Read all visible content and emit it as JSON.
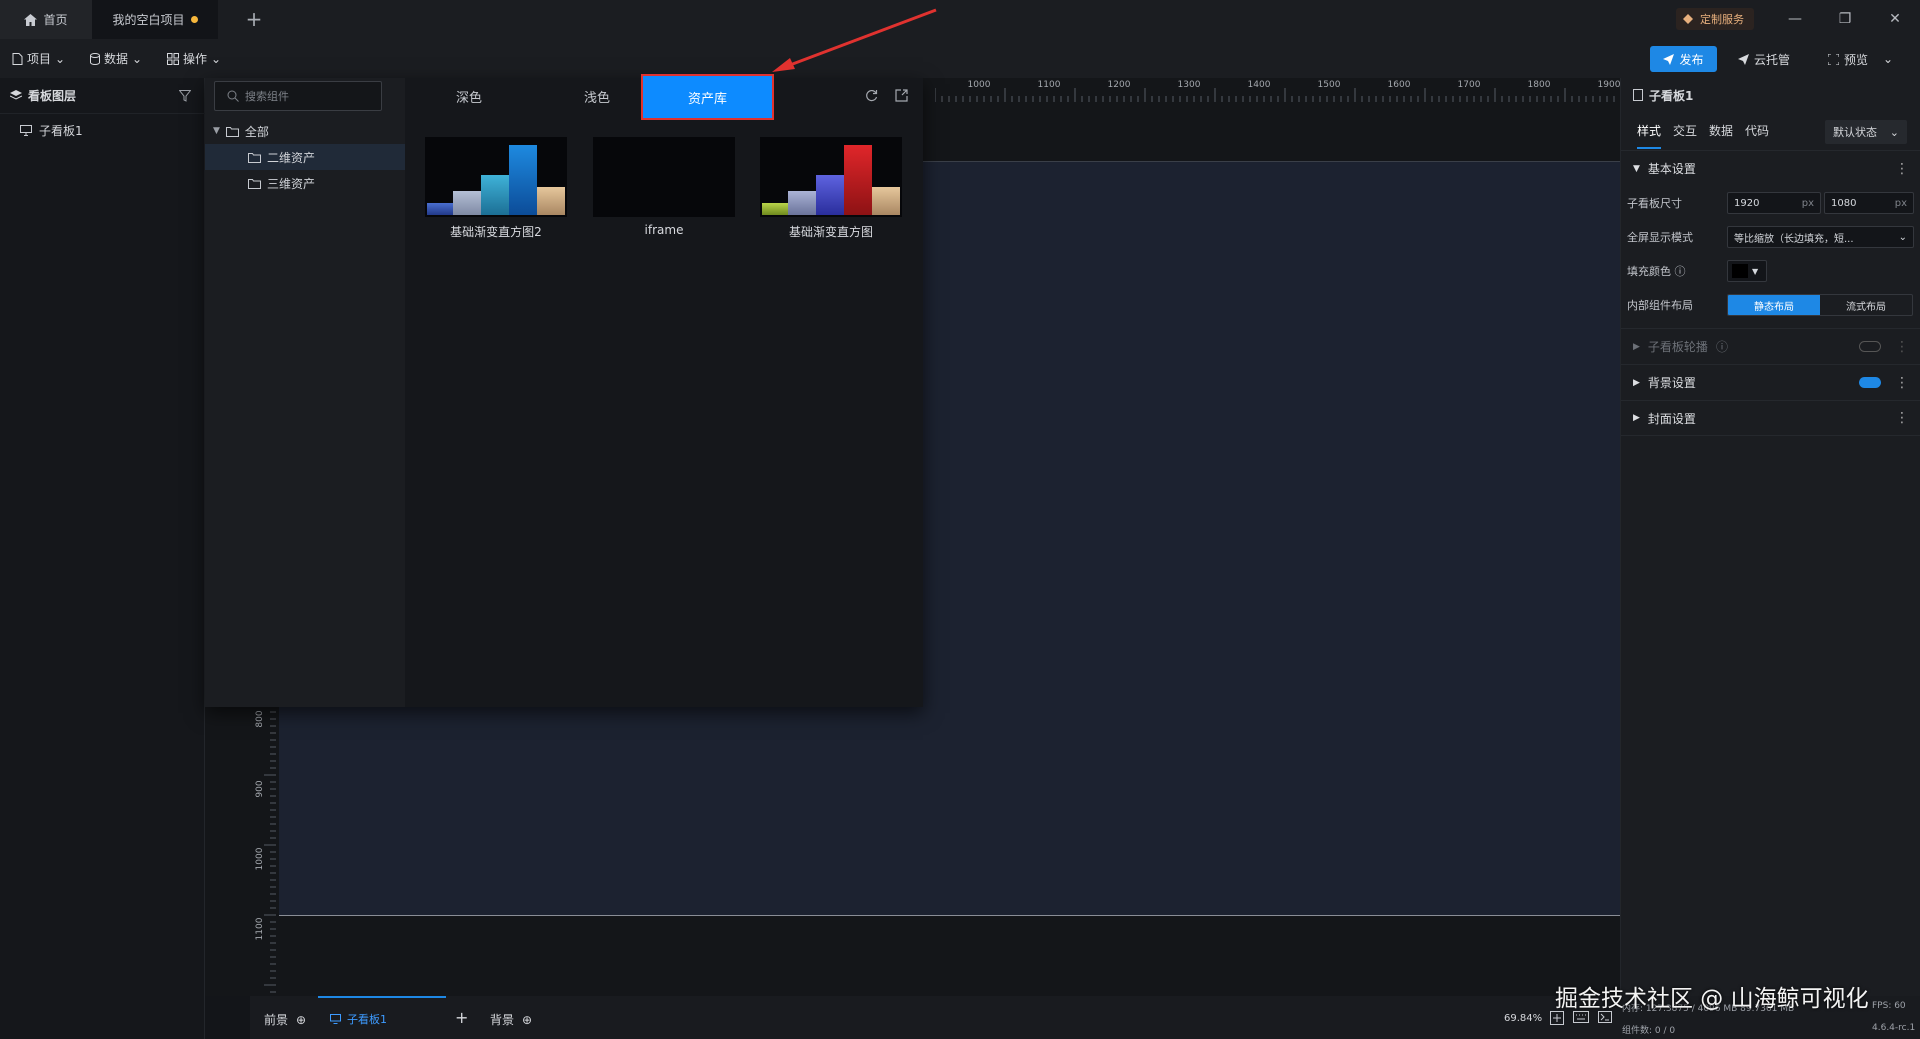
{
  "titlebar": {
    "home_tab": "首页",
    "project_tab": "我的空白项目",
    "custom_service": "定制服务",
    "add_tab": "+"
  },
  "menubar": {
    "project": "项目",
    "data": "数据",
    "operation": "操作",
    "publish": "发布",
    "cloud_hosting": "云托管",
    "preview": "预览"
  },
  "layers": {
    "title": "看板图层",
    "items": [
      {
        "label": "子看板1"
      }
    ]
  },
  "asset_panel": {
    "search_placeholder": "搜索组件",
    "tree": [
      {
        "label": "全部"
      },
      {
        "label": "二维资产"
      },
      {
        "label": "三维资产"
      }
    ],
    "tabs": [
      {
        "label": "深色"
      },
      {
        "label": "浅色"
      },
      {
        "label": "资产库"
      }
    ],
    "assets": [
      {
        "label": "基础渐变直方图2"
      },
      {
        "label": "iframe"
      },
      {
        "label": "基础渐变直方图"
      }
    ]
  },
  "ruler": {
    "top": [
      "1000",
      "1100",
      "1200",
      "1300",
      "1400",
      "1500",
      "1600",
      "1700",
      "1800",
      "1900"
    ],
    "left": [
      "800",
      "900",
      "1000",
      "1100"
    ]
  },
  "props": {
    "title": "子看板1",
    "tabs": [
      {
        "label": "样式"
      },
      {
        "label": "交互"
      },
      {
        "label": "数据"
      },
      {
        "label": "代码"
      }
    ],
    "state_select": "默认状态",
    "basic_settings": "基本设置",
    "size_label": "子看板尺寸",
    "width": "1920",
    "height": "1080",
    "unit": "px",
    "fullscreen_label": "全屏显示模式",
    "fullscreen_value": "等比缩放（长边填充，短...",
    "fill_color_label": "填充颜色",
    "layout_label": "内部组件布局",
    "layout_static": "静态布局",
    "layout_flow": "流式布局",
    "carousel": "子看板轮播",
    "background": "背景设置",
    "cover": "封面设置"
  },
  "bottom": {
    "foreground": "前景",
    "subboard": "子看板1",
    "background": "背景",
    "zoom": "69.84%",
    "memory": "内存: 127.3875 / 4096 MB  89.7361 MB",
    "fps": "FPS: 60",
    "components": "组件数: 0 / 0",
    "version": "4.6.4-rc.1"
  },
  "watermark": "掘金技术社区 @ 山海鲸可视化",
  "colors": {
    "accent": "#1e88e5",
    "highlight_border": "#e0322f",
    "arrow": "#e0322f"
  }
}
